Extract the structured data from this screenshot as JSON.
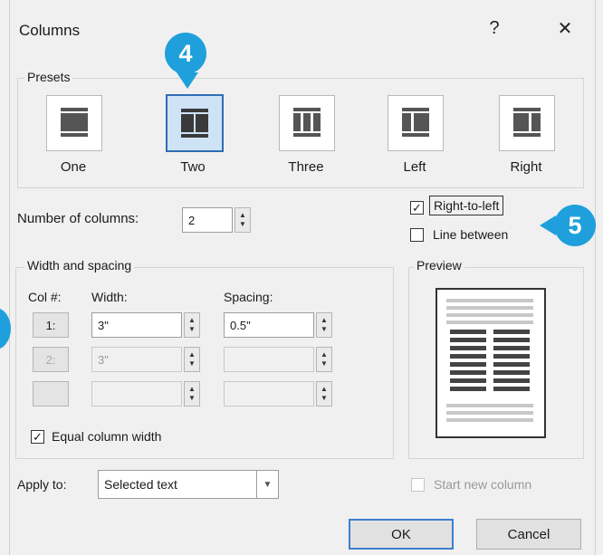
{
  "dialog": {
    "title": "Columns",
    "help_icon": "?",
    "close_icon": "✕"
  },
  "presets": {
    "label": "Presets",
    "items": [
      {
        "label": "One",
        "icon": "one-column-icon",
        "selected": false
      },
      {
        "label": "Two",
        "icon": "two-column-icon",
        "selected": true
      },
      {
        "label": "Three",
        "icon": "three-column-icon",
        "selected": false
      },
      {
        "label": "Left",
        "icon": "left-column-icon",
        "selected": false
      },
      {
        "label": "Right",
        "icon": "right-column-icon",
        "selected": false
      }
    ]
  },
  "num_columns": {
    "label": "Number of columns:",
    "value": "2"
  },
  "right_to_left": {
    "label": "Right-to-left",
    "checked": true
  },
  "line_between": {
    "label": "Line between",
    "checked": false
  },
  "width_spacing": {
    "label": "Width and spacing",
    "col_header": "Col #:",
    "width_header": "Width:",
    "spacing_header": "Spacing:",
    "rows": [
      {
        "col": "1:",
        "width": "3\"",
        "spacing": "0.5\""
      },
      {
        "col": "2:",
        "width": "3\"",
        "spacing": ""
      },
      {
        "col": "",
        "width": "",
        "spacing": ""
      }
    ]
  },
  "equal_width": {
    "label": "Equal column width",
    "checked": true
  },
  "preview": {
    "label": "Preview"
  },
  "apply_to": {
    "label": "Apply to:",
    "value": "Selected text"
  },
  "start_new_column": {
    "label": "Start new column",
    "checked": false
  },
  "buttons": {
    "ok": "OK",
    "cancel": "Cancel"
  },
  "callouts": {
    "four": "4",
    "five": "5"
  },
  "colors": {
    "callout": "#1fa0dc",
    "selected_preset": "#cfe3f7",
    "selected_border": "#2f6db5"
  }
}
